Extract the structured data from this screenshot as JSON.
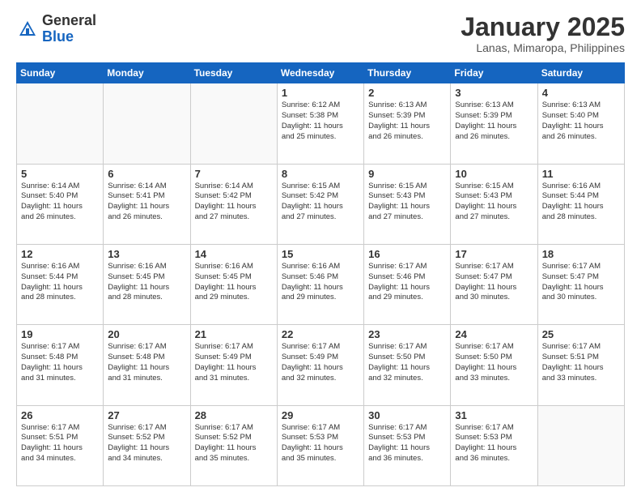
{
  "header": {
    "logo_general": "General",
    "logo_blue": "Blue",
    "month_title": "January 2025",
    "location": "Lanas, Mimaropa, Philippines"
  },
  "days_of_week": [
    "Sunday",
    "Monday",
    "Tuesday",
    "Wednesday",
    "Thursday",
    "Friday",
    "Saturday"
  ],
  "weeks": [
    [
      {
        "day": "",
        "info": ""
      },
      {
        "day": "",
        "info": ""
      },
      {
        "day": "",
        "info": ""
      },
      {
        "day": "1",
        "info": "Sunrise: 6:12 AM\nSunset: 5:38 PM\nDaylight: 11 hours\nand 25 minutes."
      },
      {
        "day": "2",
        "info": "Sunrise: 6:13 AM\nSunset: 5:39 PM\nDaylight: 11 hours\nand 26 minutes."
      },
      {
        "day": "3",
        "info": "Sunrise: 6:13 AM\nSunset: 5:39 PM\nDaylight: 11 hours\nand 26 minutes."
      },
      {
        "day": "4",
        "info": "Sunrise: 6:13 AM\nSunset: 5:40 PM\nDaylight: 11 hours\nand 26 minutes."
      }
    ],
    [
      {
        "day": "5",
        "info": "Sunrise: 6:14 AM\nSunset: 5:40 PM\nDaylight: 11 hours\nand 26 minutes."
      },
      {
        "day": "6",
        "info": "Sunrise: 6:14 AM\nSunset: 5:41 PM\nDaylight: 11 hours\nand 26 minutes."
      },
      {
        "day": "7",
        "info": "Sunrise: 6:14 AM\nSunset: 5:42 PM\nDaylight: 11 hours\nand 27 minutes."
      },
      {
        "day": "8",
        "info": "Sunrise: 6:15 AM\nSunset: 5:42 PM\nDaylight: 11 hours\nand 27 minutes."
      },
      {
        "day": "9",
        "info": "Sunrise: 6:15 AM\nSunset: 5:43 PM\nDaylight: 11 hours\nand 27 minutes."
      },
      {
        "day": "10",
        "info": "Sunrise: 6:15 AM\nSunset: 5:43 PM\nDaylight: 11 hours\nand 27 minutes."
      },
      {
        "day": "11",
        "info": "Sunrise: 6:16 AM\nSunset: 5:44 PM\nDaylight: 11 hours\nand 28 minutes."
      }
    ],
    [
      {
        "day": "12",
        "info": "Sunrise: 6:16 AM\nSunset: 5:44 PM\nDaylight: 11 hours\nand 28 minutes."
      },
      {
        "day": "13",
        "info": "Sunrise: 6:16 AM\nSunset: 5:45 PM\nDaylight: 11 hours\nand 28 minutes."
      },
      {
        "day": "14",
        "info": "Sunrise: 6:16 AM\nSunset: 5:45 PM\nDaylight: 11 hours\nand 29 minutes."
      },
      {
        "day": "15",
        "info": "Sunrise: 6:16 AM\nSunset: 5:46 PM\nDaylight: 11 hours\nand 29 minutes."
      },
      {
        "day": "16",
        "info": "Sunrise: 6:17 AM\nSunset: 5:46 PM\nDaylight: 11 hours\nand 29 minutes."
      },
      {
        "day": "17",
        "info": "Sunrise: 6:17 AM\nSunset: 5:47 PM\nDaylight: 11 hours\nand 30 minutes."
      },
      {
        "day": "18",
        "info": "Sunrise: 6:17 AM\nSunset: 5:47 PM\nDaylight: 11 hours\nand 30 minutes."
      }
    ],
    [
      {
        "day": "19",
        "info": "Sunrise: 6:17 AM\nSunset: 5:48 PM\nDaylight: 11 hours\nand 31 minutes."
      },
      {
        "day": "20",
        "info": "Sunrise: 6:17 AM\nSunset: 5:48 PM\nDaylight: 11 hours\nand 31 minutes."
      },
      {
        "day": "21",
        "info": "Sunrise: 6:17 AM\nSunset: 5:49 PM\nDaylight: 11 hours\nand 31 minutes."
      },
      {
        "day": "22",
        "info": "Sunrise: 6:17 AM\nSunset: 5:49 PM\nDaylight: 11 hours\nand 32 minutes."
      },
      {
        "day": "23",
        "info": "Sunrise: 6:17 AM\nSunset: 5:50 PM\nDaylight: 11 hours\nand 32 minutes."
      },
      {
        "day": "24",
        "info": "Sunrise: 6:17 AM\nSunset: 5:50 PM\nDaylight: 11 hours\nand 33 minutes."
      },
      {
        "day": "25",
        "info": "Sunrise: 6:17 AM\nSunset: 5:51 PM\nDaylight: 11 hours\nand 33 minutes."
      }
    ],
    [
      {
        "day": "26",
        "info": "Sunrise: 6:17 AM\nSunset: 5:51 PM\nDaylight: 11 hours\nand 34 minutes."
      },
      {
        "day": "27",
        "info": "Sunrise: 6:17 AM\nSunset: 5:52 PM\nDaylight: 11 hours\nand 34 minutes."
      },
      {
        "day": "28",
        "info": "Sunrise: 6:17 AM\nSunset: 5:52 PM\nDaylight: 11 hours\nand 35 minutes."
      },
      {
        "day": "29",
        "info": "Sunrise: 6:17 AM\nSunset: 5:53 PM\nDaylight: 11 hours\nand 35 minutes."
      },
      {
        "day": "30",
        "info": "Sunrise: 6:17 AM\nSunset: 5:53 PM\nDaylight: 11 hours\nand 36 minutes."
      },
      {
        "day": "31",
        "info": "Sunrise: 6:17 AM\nSunset: 5:53 PM\nDaylight: 11 hours\nand 36 minutes."
      },
      {
        "day": "",
        "info": ""
      }
    ]
  ]
}
